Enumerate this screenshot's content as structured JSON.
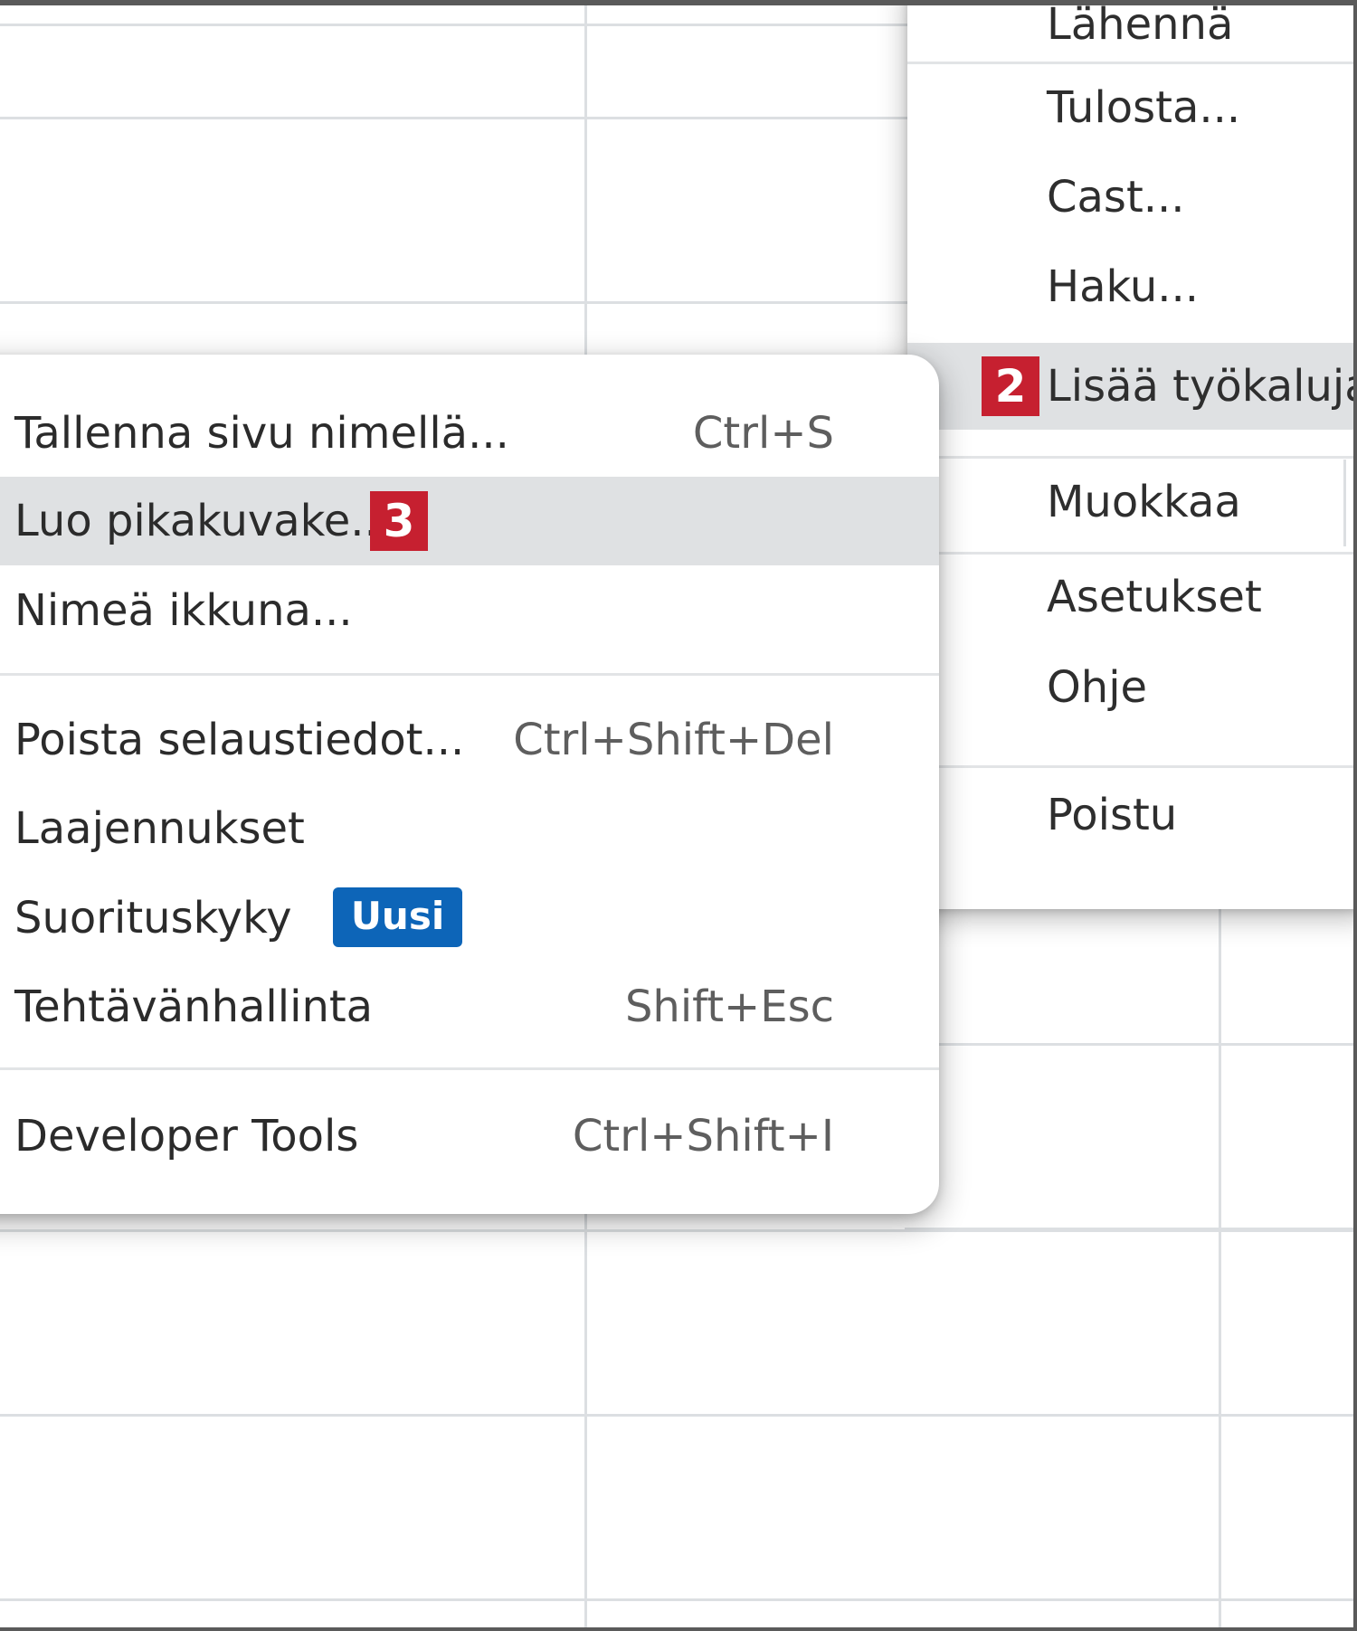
{
  "main_menu": {
    "items": [
      {
        "label": "Lähennä"
      },
      {
        "label": "Tulosta..."
      },
      {
        "label": "Cast..."
      },
      {
        "label": "Haku..."
      },
      {
        "label": "Lisää työkaluja",
        "step": "2"
      },
      {
        "label": "Muokkaa"
      },
      {
        "label": "Asetukset"
      },
      {
        "label": "Ohje"
      },
      {
        "label": "Poistu"
      }
    ]
  },
  "sub_menu": {
    "items": [
      {
        "label": "Tallenna sivu nimellä...",
        "shortcut": "Ctrl+S"
      },
      {
        "label": "Luo pikakuvake...",
        "step": "3"
      },
      {
        "label": "Nimeä ikkuna..."
      },
      {
        "label": "Poista selaustiedot...",
        "shortcut": "Ctrl+Shift+Del"
      },
      {
        "label": "Laajennukset"
      },
      {
        "label": "Suorituskyky",
        "badge": "Uusi"
      },
      {
        "label": "Tehtävänhallinta",
        "shortcut": "Shift+Esc"
      },
      {
        "label": "Developer Tools",
        "shortcut": "Ctrl+Shift+I"
      }
    ]
  },
  "colors": {
    "step_badge": "#c62030",
    "new_badge": "#0d65b8",
    "highlight": "#dfe1e3"
  }
}
